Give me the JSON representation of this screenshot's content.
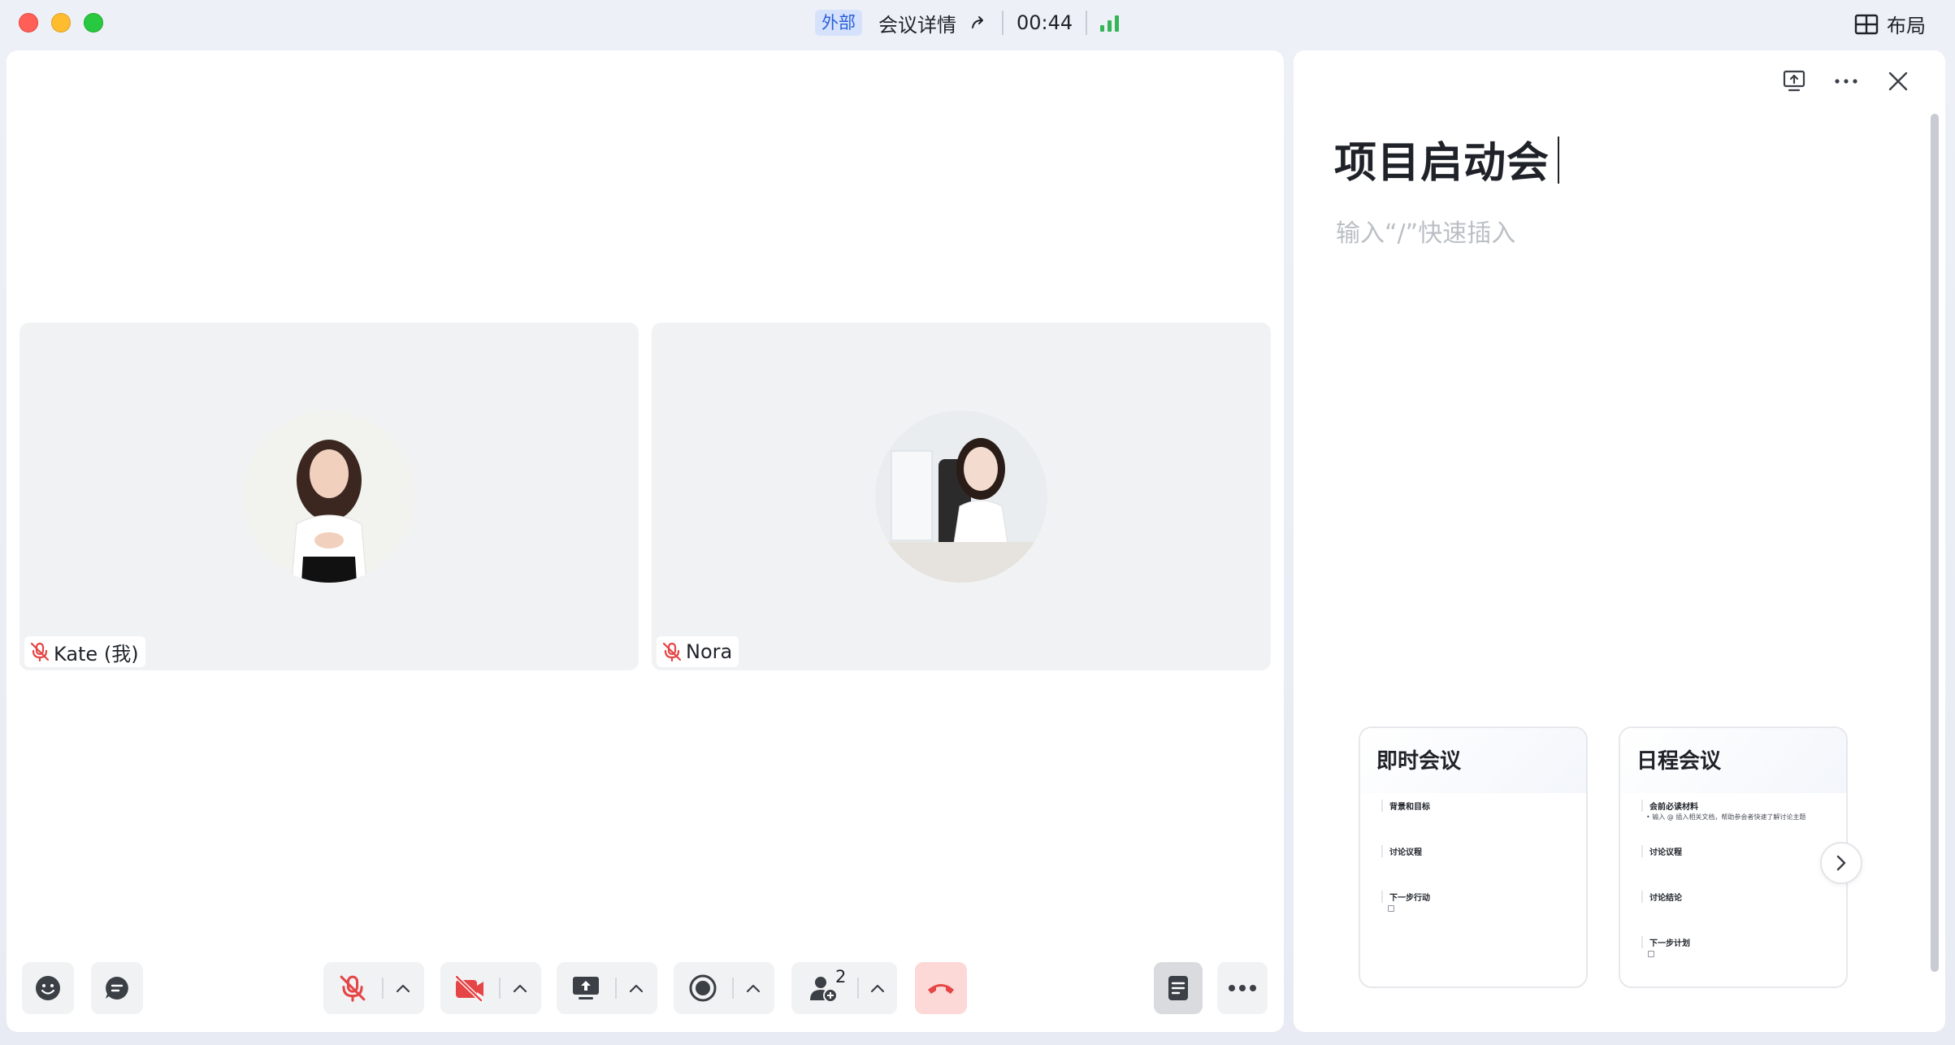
{
  "titlebar": {
    "external_badge": "外部",
    "meeting_details": "会议详情",
    "timer": "00:44",
    "layout_label": "布局"
  },
  "participants": [
    {
      "name": "Kate (我)",
      "muted": true
    },
    {
      "name": "Nora",
      "muted": true
    }
  ],
  "toolbar": {
    "participant_count": "2",
    "colors": {
      "mute_red": "#e54545",
      "hangup_bg": "#fcd9d6",
      "signal_green": "#34b557",
      "badge_blue": "#2a5fdb"
    }
  },
  "document": {
    "title": "项目启动会",
    "placeholder": "输入“/”快速插入",
    "templates": [
      {
        "title": "即时会议",
        "items": [
          {
            "label": "背景和目标"
          },
          {
            "label": "讨论议程"
          },
          {
            "label": "下一步行动",
            "checkbox": true
          }
        ]
      },
      {
        "title": "日程会议",
        "items": [
          {
            "label": "会前必读材料",
            "sub": "•  输入 @ 插入相关文档，帮助参会者快速了解讨论主题"
          },
          {
            "label": "讨论议程"
          },
          {
            "label": "讨论结论"
          },
          {
            "label": "下一步计划",
            "checkbox": true
          }
        ]
      }
    ]
  }
}
